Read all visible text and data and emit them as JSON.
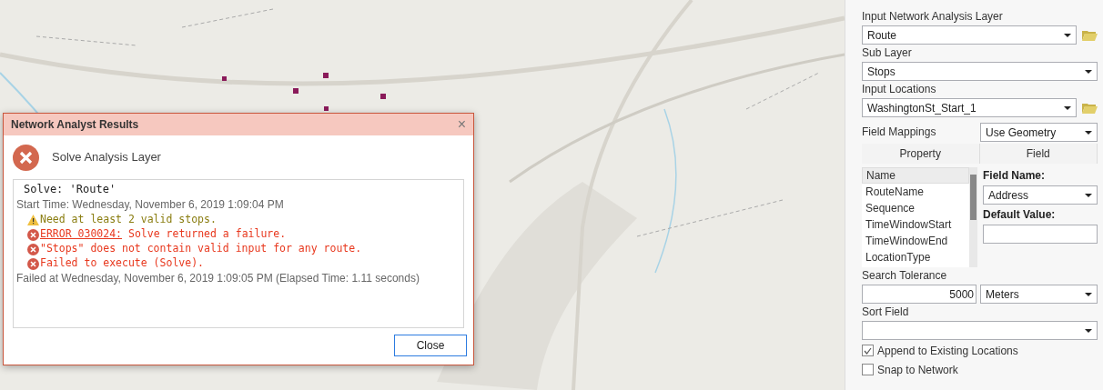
{
  "dialog": {
    "title": "Network Analyst Results",
    "close_glyph": "×",
    "heading": "Solve Analysis Layer",
    "messages": [
      {
        "kind": "command",
        "text": "Solve: 'Route'"
      },
      {
        "kind": "info",
        "text": "Start Time: Wednesday, November 6, 2019 1:09:04 PM"
      },
      {
        "kind": "warning",
        "text": "Need at least 2 valid stops."
      },
      {
        "kind": "error",
        "code": "ERROR 030024:",
        "text": "Solve returned a failure."
      },
      {
        "kind": "error",
        "text": "\"Stops\" does not contain valid input for any route."
      },
      {
        "kind": "error",
        "text": "Failed to execute (Solve)."
      },
      {
        "kind": "info",
        "text": "Failed at Wednesday, November 6, 2019 1:09:05 PM (Elapsed Time: 1.11 seconds)"
      }
    ],
    "button": "Close"
  },
  "panel": {
    "network_layer": {
      "label": "Input Network Analysis Layer",
      "value": "Route"
    },
    "sub_layer": {
      "label": "Sub Layer",
      "value": "Stops"
    },
    "input_locations": {
      "label": "Input Locations",
      "value": "WashingtonSt_Start_1"
    },
    "field_mappings": {
      "label": "Field Mappings",
      "value": "Use Geometry"
    },
    "mapping_columns": [
      {
        "label": "Property"
      },
      {
        "label": "Field"
      }
    ],
    "properties": [
      {
        "label": "Name",
        "selected": true
      },
      {
        "label": "RouteName",
        "selected": false
      },
      {
        "label": "Sequence",
        "selected": false
      },
      {
        "label": "TimeWindowStart",
        "selected": false
      },
      {
        "label": "TimeWindowEnd",
        "selected": false
      },
      {
        "label": "LocationType",
        "selected": false
      }
    ],
    "field_name": {
      "label": "Field Name:",
      "value": "Address"
    },
    "default_value": {
      "label": "Default Value:"
    },
    "search_tolerance": {
      "label": "Search Tolerance",
      "value": "5000",
      "unit": "Meters"
    },
    "sort_field": {
      "label": "Sort Field"
    },
    "checkboxes": [
      {
        "label": "Append to Existing Locations",
        "checked": true
      },
      {
        "label": "Snap to Network",
        "checked": false
      }
    ]
  }
}
